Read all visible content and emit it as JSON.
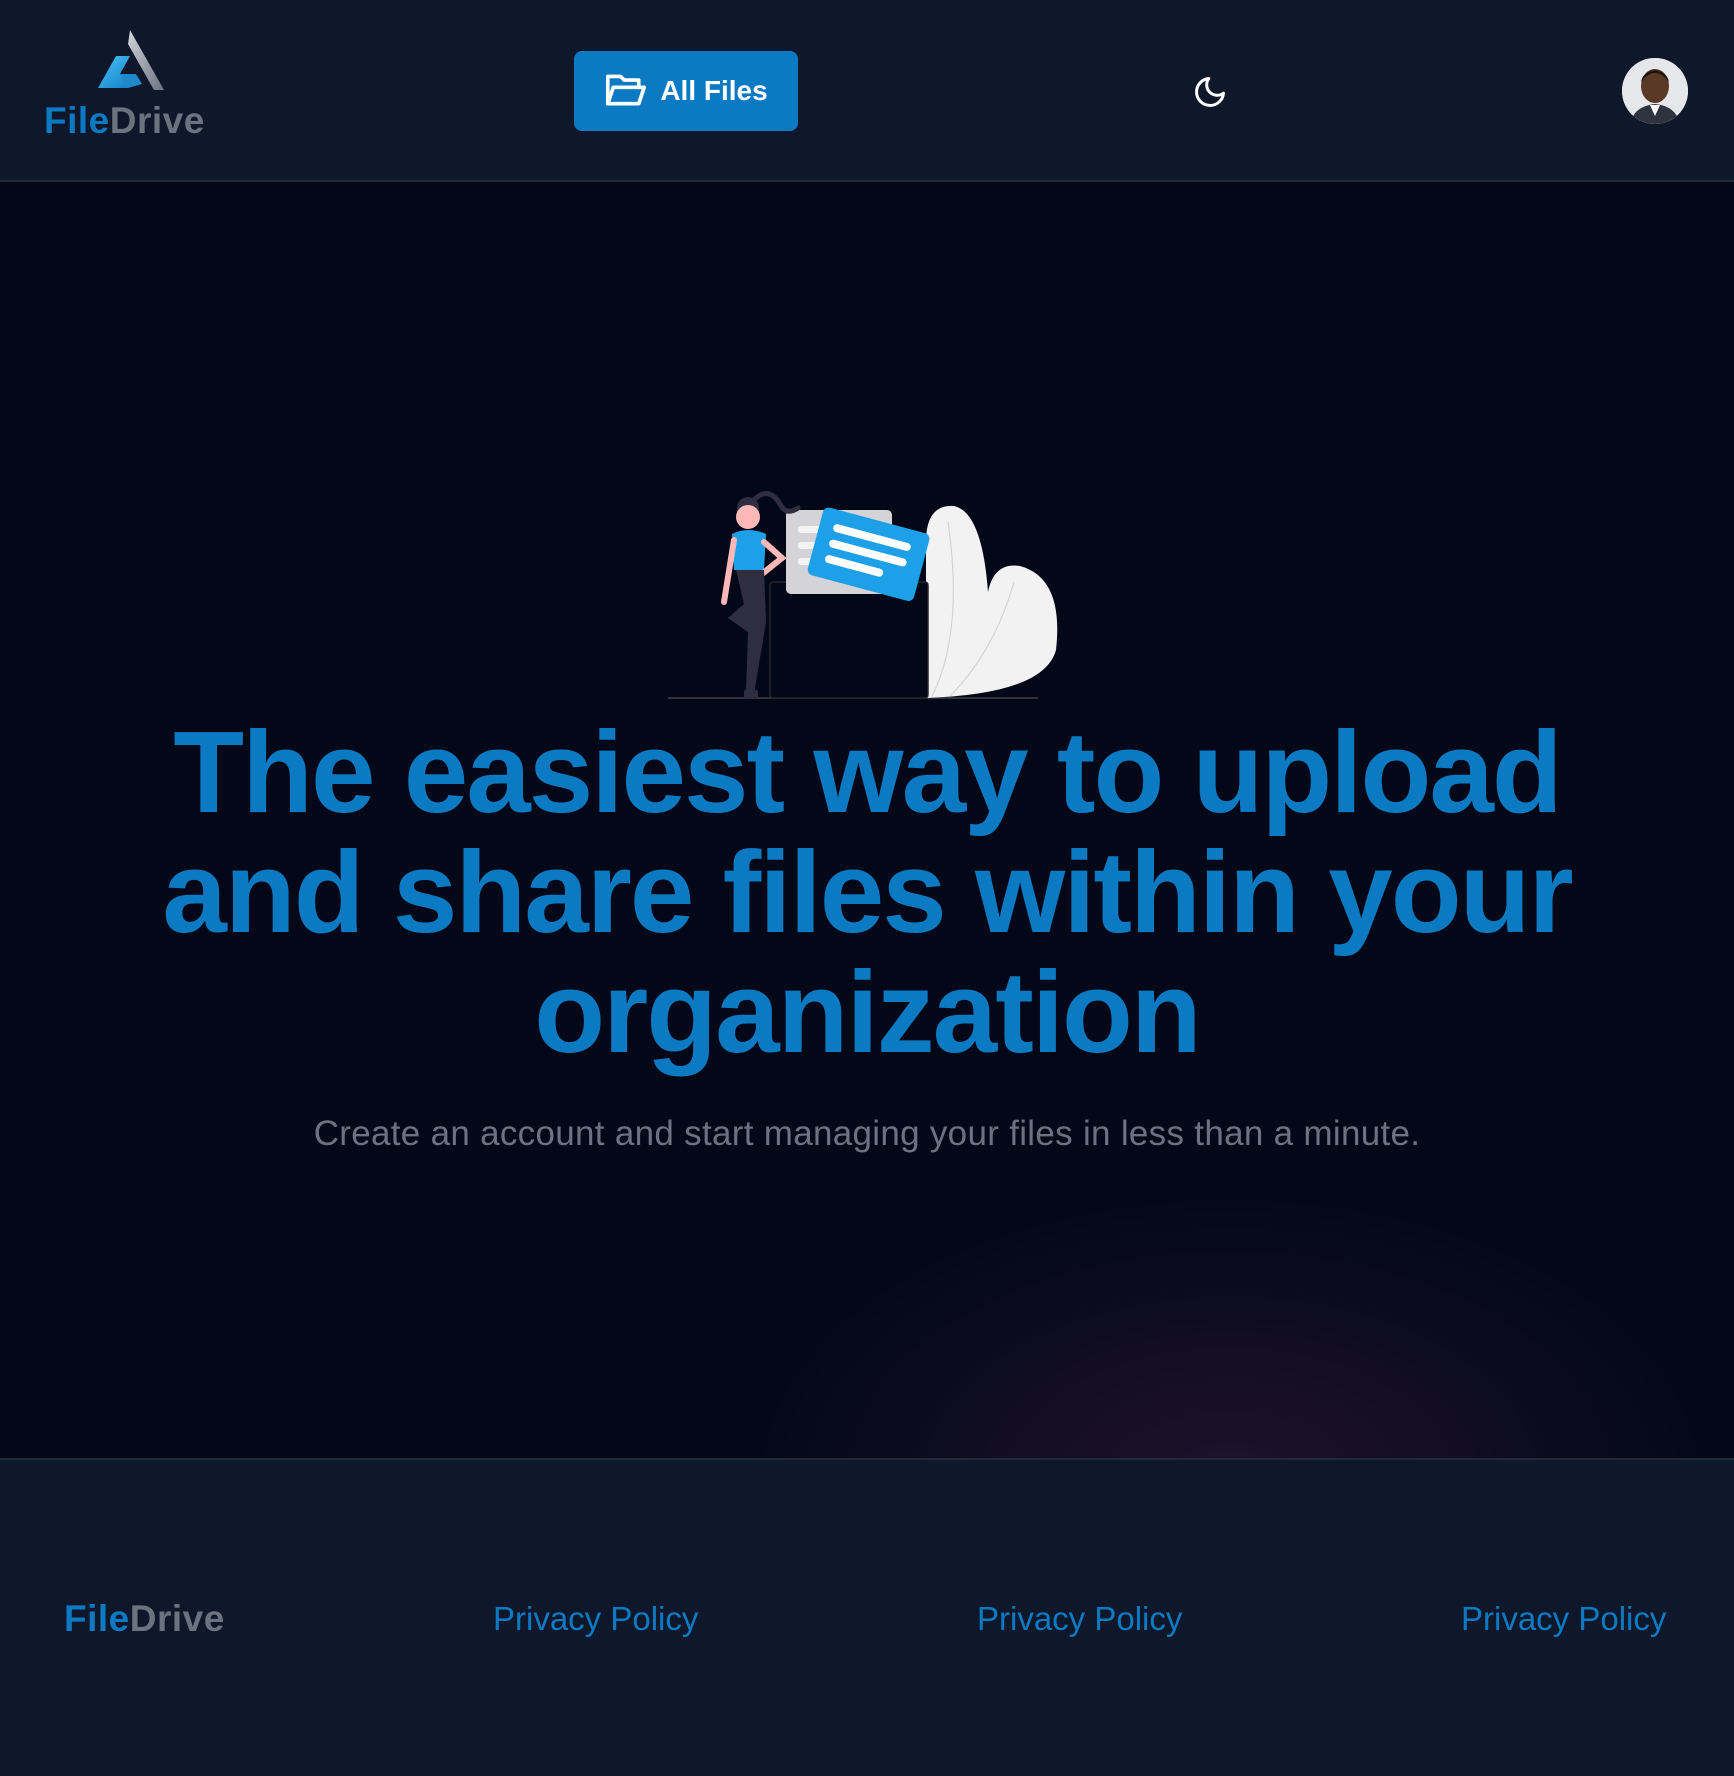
{
  "brand": {
    "name_part1": "File",
    "name_part2": "Drive",
    "accent_color": "#0c7ac3",
    "secondary_color": "#6b7280",
    "logo_icon": "triangle-logo-icon"
  },
  "header": {
    "nav_button": {
      "label": "All Files",
      "icon": "folder-open-icon"
    },
    "theme_toggle_icon": "moon-icon",
    "avatar_icon": "user-avatar"
  },
  "hero": {
    "illustration": "woman-with-folder-illustration",
    "headline": "The easiest way to upload and share files within your organization",
    "subtitle": "Create an account and start managing your files in less than a minute."
  },
  "footer": {
    "brand_part1": "File",
    "brand_part2": "Drive",
    "links": [
      {
        "label": "Privacy Policy"
      },
      {
        "label": "Privacy Policy"
      },
      {
        "label": "Privacy Policy"
      }
    ]
  },
  "colors": {
    "header_bg": "#0f172a",
    "hero_bg": "#020817",
    "button_bg": "#0c7ac3",
    "headline": "#0c7ac3",
    "subtitle": "#6b7280"
  }
}
